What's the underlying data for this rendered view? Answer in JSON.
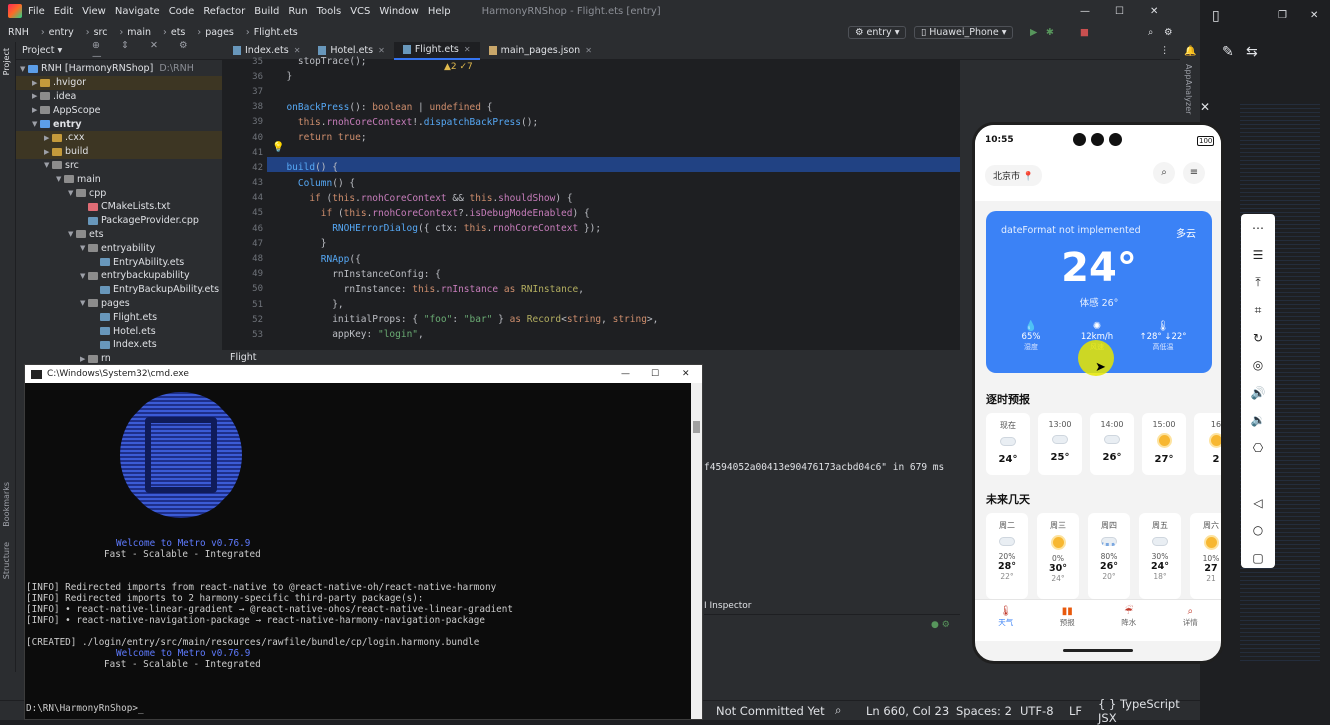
{
  "menu": {
    "items": [
      "File",
      "Edit",
      "View",
      "Navigate",
      "Code",
      "Refactor",
      "Build",
      "Run",
      "Tools",
      "VCS",
      "Window",
      "Help"
    ],
    "title": "HarmonyRNShop - Flight.ets [entry]"
  },
  "toolbar": {
    "breadcrumb": [
      "RNH",
      "entry",
      "src",
      "main",
      "ets",
      "pages",
      "Flight.ets"
    ],
    "config": "entry",
    "device": "Huawei_Phone"
  },
  "project_panel": {
    "title": "Project",
    "tree": [
      {
        "label": "RNH [HarmonyRNShop]",
        "note": "D:\\RNH",
        "indent": 0,
        "open": true,
        "color": "#5c9ee8"
      },
      {
        "label": ".hvigor",
        "indent": 1,
        "open": false,
        "color": "#c49a3b"
      },
      {
        "label": ".idea",
        "indent": 1,
        "open": false,
        "color": "#8c8c8c"
      },
      {
        "label": "AppScope",
        "indent": 1,
        "open": false,
        "color": "#8c8c8c"
      },
      {
        "label": "entry",
        "indent": 1,
        "open": true,
        "color": "#5c9ee8",
        "bold": true
      },
      {
        "label": ".cxx",
        "indent": 2,
        "open": false,
        "color": "#c49a3b"
      },
      {
        "label": "build",
        "indent": 2,
        "open": false,
        "color": "#c49a3b"
      },
      {
        "label": "src",
        "indent": 2,
        "open": true,
        "color": "#8c8c8c"
      },
      {
        "label": "main",
        "indent": 3,
        "open": true,
        "color": "#8c8c8c"
      },
      {
        "label": "cpp",
        "indent": 4,
        "open": true,
        "color": "#8c8c8c"
      },
      {
        "label": "CMakeLists.txt",
        "indent": 5,
        "leaf": true,
        "color": "#e06c75"
      },
      {
        "label": "PackageProvider.cpp",
        "indent": 5,
        "leaf": true,
        "color": "#6897bb"
      },
      {
        "label": "ets",
        "indent": 4,
        "open": true,
        "color": "#8c8c8c"
      },
      {
        "label": "entryability",
        "indent": 5,
        "open": true,
        "color": "#8c8c8c"
      },
      {
        "label": "EntryAbility.ets",
        "indent": 6,
        "leaf": true,
        "color": "#6897bb"
      },
      {
        "label": "entrybackupability",
        "indent": 5,
        "open": true,
        "color": "#8c8c8c"
      },
      {
        "label": "EntryBackupAbility.ets",
        "indent": 6,
        "leaf": true,
        "color": "#6897bb"
      },
      {
        "label": "pages",
        "indent": 5,
        "open": true,
        "color": "#8c8c8c"
      },
      {
        "label": "Flight.ets",
        "indent": 6,
        "leaf": true,
        "color": "#6897bb"
      },
      {
        "label": "Hotel.ets",
        "indent": 6,
        "leaf": true,
        "color": "#6897bb"
      },
      {
        "label": "Index.ets",
        "indent": 6,
        "leaf": true,
        "color": "#6897bb"
      },
      {
        "label": "rn",
        "indent": 5,
        "open": false,
        "color": "#8c8c8c"
      }
    ]
  },
  "tabs": [
    {
      "label": "Index.ets",
      "active": false
    },
    {
      "label": "Hotel.ets",
      "active": false
    },
    {
      "label": "Flight.ets",
      "active": true
    },
    {
      "label": "main_pages.json",
      "active": false
    }
  ],
  "editor": {
    "inspections": "▲2  ✓7",
    "lines": [
      {
        "n": "35",
        "html": "    <span class='tx'>stopTrace();</span>"
      },
      {
        "n": "36",
        "html": "  <span class='tx'>}</span>"
      },
      {
        "n": "37",
        "html": ""
      },
      {
        "n": "38",
        "html": "  <span class='fn'>onBackPress</span><span class='tx'>(): </span><span class='kw'>boolean</span><span class='tx'> | </span><span class='kw'>undefined</span><span class='tx'> {</span>"
      },
      {
        "n": "39",
        "html": "    <span class='kw'>this</span><span class='tx'>.</span><span class='pur'>rnohCoreContext</span><span class='tx'>!.</span><span class='fn'>dispatchBackPress</span><span class='tx'>();</span>"
      },
      {
        "n": "40",
        "html": "    <span class='kw'>return true</span><span class='tx'>;</span>"
      },
      {
        "n": "41",
        "html": ""
      },
      {
        "n": "42",
        "html": "  <span class='fn'>build</span><span class='tx'>() {</span>"
      },
      {
        "n": "43",
        "html": "    <span class='fn'>Column</span><span class='tx'>() {</span>"
      },
      {
        "n": "44",
        "html": "      <span class='kw'>if</span><span class='tx'> (</span><span class='kw'>this</span><span class='tx'>.</span><span class='pur'>rnohCoreContext</span><span class='tx'> &amp;&amp; </span><span class='kw'>this</span><span class='tx'>.</span><span class='pur'>shouldShow</span><span class='tx'>) {</span>"
      },
      {
        "n": "45",
        "html": "        <span class='kw'>if</span><span class='tx'> (</span><span class='kw'>this</span><span class='tx'>.</span><span class='pur'>rnohCoreContext</span><span class='tx'>?.</span><span class='pur'>isDebugModeEnabled</span><span class='tx'>) {</span>"
      },
      {
        "n": "46",
        "html": "          <span class='fn'>RNOHErrorDialog</span><span class='tx'>({ ctx: </span><span class='kw'>this</span><span class='tx'>.</span><span class='pur'>rnohCoreContext</span><span class='tx'> });</span>"
      },
      {
        "n": "47",
        "html": "        <span class='tx'>}</span>"
      },
      {
        "n": "48",
        "html": "        <span class='fn'>RNApp</span><span class='tx'>({</span>"
      },
      {
        "n": "49",
        "html": "          <span class='tx'>rnInstanceConfig: {</span>"
      },
      {
        "n": "50",
        "html": "            <span class='tx'>rnInstance: </span><span class='kw'>this</span><span class='tx'>.</span><span class='pur'>rnInstance</span><span class='tx'> </span><span class='kw'>as</span><span class='tx'> </span><span class='typ'>RNInstance</span><span class='tx'>,</span>"
      },
      {
        "n": "51",
        "html": "          <span class='tx'>},</span>"
      },
      {
        "n": "52",
        "html": "          <span class='tx'>initialProps: { </span><span class='str'>\"foo\"</span><span class='tx'>: </span><span class='str'>\"bar\"</span><span class='tx'> } </span><span class='kw'>as</span><span class='tx'> </span><span class='typ'>Record</span><span class='tx'>&lt;</span><span class='kw'>string</span><span class='tx'>, </span><span class='kw'>string</span><span class='tx'>&gt;,</span>"
      },
      {
        "n": "53",
        "html": "          <span class='tx'>appKey: </span><span class='str'>\"login\"</span><span class='tx'>,</span>"
      }
    ]
  },
  "editor_crumb": "Flight",
  "run_panel": {
    "log": "f4594052a00413e90476173acbd04c6\" in 679 ms",
    "inspector": "I Inspector"
  },
  "cmd": {
    "title": "C:\\Windows\\System32\\cmd.exe",
    "welcome": "Welcome to Metro v0.76.9",
    "tagline": "Fast - Scalable - Integrated",
    "lines": [
      "[INFO] Redirected imports from react-native to @react-native-oh/react-native-harmony",
      "[INFO] Redirected imports to 2 harmony-specific third-party package(s):",
      "[INFO] • react-native-linear-gradient → @react-native-ohos/react-native-linear-gradient",
      "[INFO] • react-native-navigation-package → react-native-harmony-navigation-package",
      "",
      "[CREATED] ./login/entry/src/main/resources/rawfile/bundle/cp/login.harmony.bundle"
    ],
    "welcome2": "Welcome to Metro v0.76.9",
    "tagline2": "Fast - Scalable - Integrated",
    "prompt": "D:\\RN\\HarmonyRnShop>"
  },
  "statusbar": {
    "vcs": "Not Committed Yet",
    "position": "Ln 660, Col 23",
    "indent": "Spaces: 2",
    "encoding": "UTF-8",
    "line_sep": "LF",
    "filetype": "TypeScript JSX"
  },
  "phone": {
    "time": "10:55",
    "battery": "100",
    "city": "北京市",
    "weather": {
      "date_error": "dateFormat not implemented",
      "condition": "多云",
      "temp": "24°",
      "feels": "体感 26°",
      "stats": [
        {
          "value": "65%",
          "label": "湿度"
        },
        {
          "value": "12km/h",
          "label": "风速"
        },
        {
          "value": "↑28° ↓22°",
          "label": "高低温"
        }
      ]
    },
    "hourly_title": "逐时预报",
    "hourly": [
      {
        "time": "现在",
        "temp": "24°",
        "icon": "cloud"
      },
      {
        "time": "13:00",
        "temp": "25°",
        "icon": "cloud"
      },
      {
        "time": "14:00",
        "temp": "26°",
        "icon": "cloud"
      },
      {
        "time": "15:00",
        "temp": "27°",
        "icon": "sun"
      },
      {
        "time": "16",
        "temp": "2",
        "icon": "sun"
      }
    ],
    "daily_title": "未来几天",
    "daily": [
      {
        "day": "周二",
        "icon": "cloud",
        "pop": "20%",
        "hi": "28°",
        "lo": "22°"
      },
      {
        "day": "周三",
        "icon": "sun",
        "pop": "0%",
        "hi": "30°",
        "lo": "24°"
      },
      {
        "day": "周四",
        "icon": "rain",
        "pop": "80%",
        "hi": "26°",
        "lo": "20°"
      },
      {
        "day": "周五",
        "icon": "cloud",
        "pop": "30%",
        "hi": "24°",
        "lo": "18°"
      },
      {
        "day": "周六",
        "icon": "sun",
        "pop": "10%",
        "hi": "27",
        "lo": "21"
      }
    ],
    "nav": [
      {
        "label": "天气",
        "active": true
      },
      {
        "label": "预报",
        "active": false
      },
      {
        "label": "降水",
        "active": false
      },
      {
        "label": "详情",
        "active": false
      }
    ]
  },
  "colors": {
    "accent": "#3b82f6",
    "ide_bg": "#2b2d30",
    "editor_bg": "#1e1f22",
    "line_highlight": "#214283",
    "metro_blue": "#3b5bd6"
  }
}
